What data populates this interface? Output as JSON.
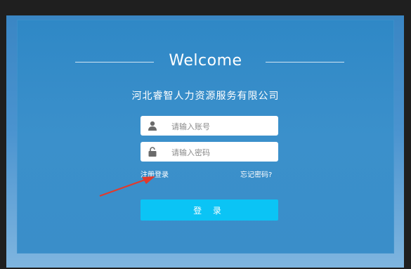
{
  "welcome_title": "Welcome",
  "company_name": "河北睿智人力资源服务有限公司",
  "username": {
    "placeholder": "请输入账号",
    "value": ""
  },
  "password": {
    "placeholder": "请输入密码",
    "value": ""
  },
  "register_link": "注册登录",
  "forgot_link": "忘记密码?",
  "login_button": "登 录",
  "icons": {
    "username": "user-icon",
    "password": "lock-icon",
    "annotation": "red-arrow"
  },
  "colors": {
    "panel": "#3b90cb",
    "button": "#0bc4f5",
    "annotation": "#e23a2c"
  }
}
